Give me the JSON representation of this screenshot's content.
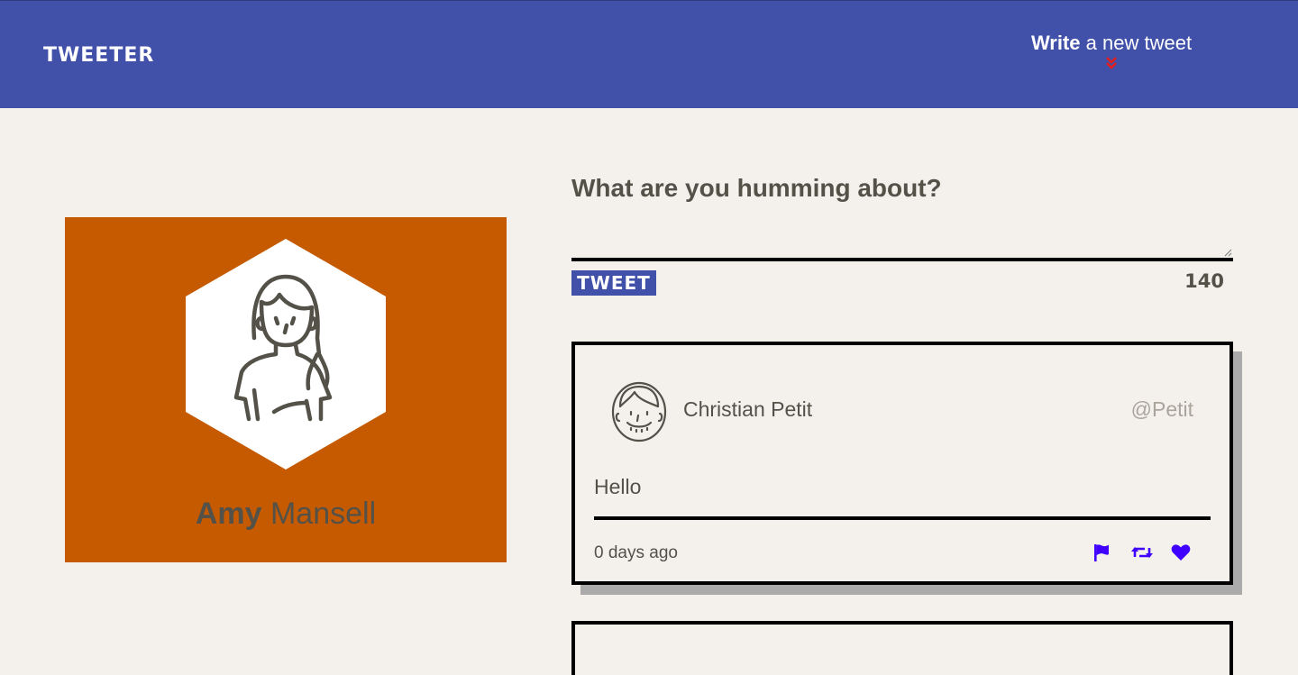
{
  "nav": {
    "brand": "TWEETER",
    "compose_bold": "Write",
    "compose_rest": " a new tweet",
    "chevron_icon": "double-chevron-down-icon",
    "chevron_color": "#e0201f"
  },
  "profile": {
    "first_name": "Amy",
    "last_name": "Mansell",
    "avatar_icon": "woman-avatar-icon",
    "background_color": "#c55a00"
  },
  "composer": {
    "title": "What are you humming about?",
    "placeholder": "",
    "button_label": "TWEET",
    "char_count": "140"
  },
  "tweets": [
    {
      "author": "Christian Petit",
      "handle": "@Petit",
      "avatar_icon": "man-avatar-icon",
      "body": "Hello",
      "timestamp": "0 days ago",
      "actions": [
        "flag-icon",
        "retweet-icon",
        "heart-icon"
      ],
      "action_color": "#3f00ff"
    }
  ],
  "colors": {
    "nav_bg": "#4150a8",
    "page_bg": "#f4f1ec",
    "text": "#545149"
  }
}
